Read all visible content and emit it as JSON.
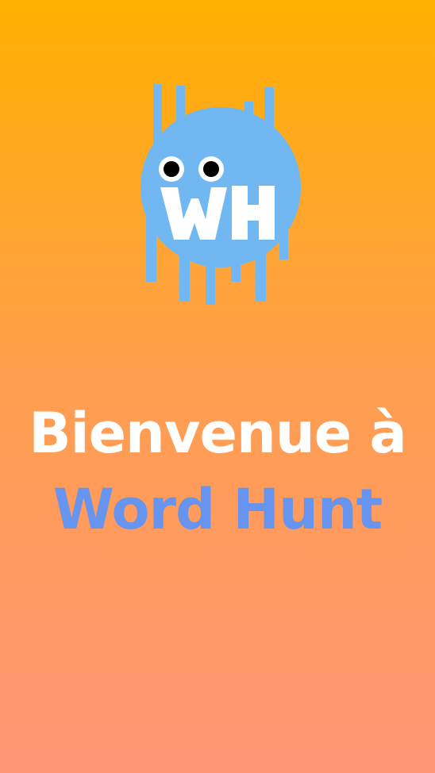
{
  "splash": {
    "logo": {
      "icon": "word-hunt-monster-icon",
      "lettering": "WH",
      "body_color": "#71B8F2",
      "letter_color": "#FFFFFF",
      "eye_color": "#000000"
    },
    "welcome_line1": "Bienvenue à",
    "welcome_line2": "Word Hunt"
  },
  "colors": {
    "background_top": "#FFB000",
    "background_bottom": "#FF9575",
    "title_primary": "#FFFFFF",
    "title_accent": "#6694EE"
  }
}
